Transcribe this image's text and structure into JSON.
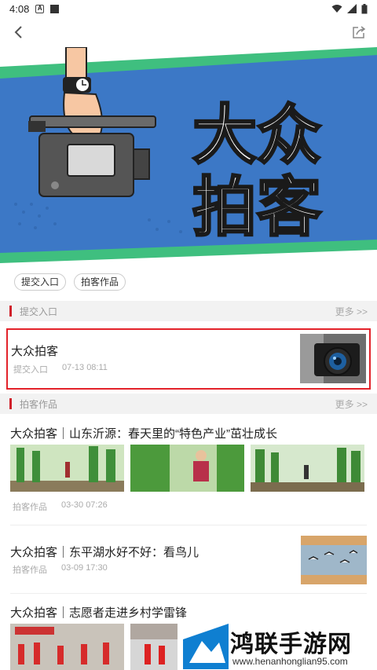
{
  "status": {
    "time": "4:08"
  },
  "banner": {
    "line1": "大众",
    "line2": "拍客"
  },
  "tags": [
    {
      "label": "提交入口"
    },
    {
      "label": "拍客作品"
    }
  ],
  "section_submit": {
    "title": "提交入口",
    "more": "更多 >>"
  },
  "featured": {
    "title": "大众拍客",
    "category": "提交入口",
    "time": "07-13 08:11"
  },
  "section_works": {
    "title": "拍客作品",
    "more": "更多 >>"
  },
  "articles": [
    {
      "title": "大众拍客｜山东沂源：春天里的“特色产业”茁壮成长",
      "category": "拍客作品",
      "time": "03-30 07:26"
    },
    {
      "title": "大众拍客｜东平湖水好不好：看鸟儿",
      "category": "拍客作品",
      "time": "03-09 17:30"
    },
    {
      "title": "大众拍客｜志愿者走进乡村学雷锋"
    }
  ],
  "watermark": {
    "title": "鸿联手游网",
    "url": "www.henanhonglian95.com"
  },
  "colors": {
    "accent": "#d0202a",
    "banner_blue": "#3c78c6",
    "banner_green": "#3fbf7f"
  }
}
